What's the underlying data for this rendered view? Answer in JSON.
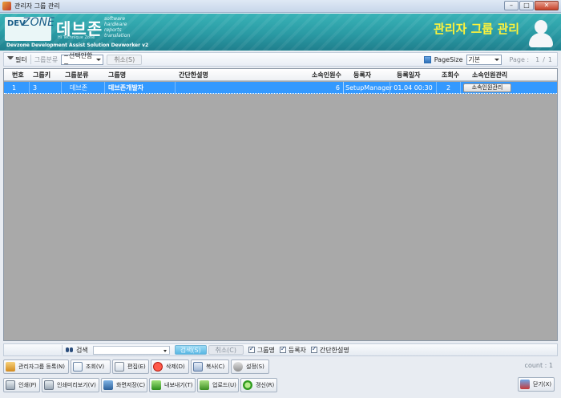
{
  "window": {
    "title": "관리자 그룹 관리"
  },
  "banner": {
    "logo_dev": "DEV",
    "logo_zone": "ZONE",
    "logo_korean": "데브존",
    "logo_tagline": "Hi Technique Zone",
    "logo_words": [
      "software",
      "hardware",
      "reports",
      "translation"
    ],
    "subtitle": "Devzone Development Assist Solution Devworker v2",
    "page_title": "관리자 그룹 관리"
  },
  "filterbar": {
    "filter_label": "필터",
    "group_class_label": "그룹분류",
    "group_class_value": "~선택안함~",
    "cancel_label": "취소(S)",
    "pagesize_label": "PageSize",
    "pagesize_value": "기본",
    "page_label": "Page :",
    "page_current": "1",
    "page_sep": "/",
    "page_total": "1"
  },
  "grid": {
    "columns": [
      "번호",
      "그룹키",
      "그룹분류",
      "그룹명",
      "간단한설명",
      "소속인원수",
      "등록자",
      "등록일자",
      "조회수",
      "소속인원관리"
    ],
    "rows": [
      {
        "no": "1",
        "key": "3",
        "class": "데브존",
        "name": "데브존개발자",
        "desc": "",
        "members": "6",
        "registrar": "SetupManager",
        "date": "01.04 00:30",
        "views": "2",
        "action": "소속인원관리"
      }
    ]
  },
  "searchbar": {
    "search_label": "검색",
    "search_value": "",
    "search_button": "검색(S)",
    "cancel_button": "취소(C)",
    "checks": [
      "그룹명",
      "등록자",
      "간단한설명"
    ]
  },
  "actions_row1": [
    "관리자그룹 등록(N)",
    "조회(V)",
    "편집(E)",
    "삭제(D)",
    "복사(C)",
    "설정(S)"
  ],
  "count_text": "count : 1",
  "actions_row2": [
    "인쇄(P)",
    "인쇄미리보기(V)",
    "화면저장(C)",
    "내보내기(T)",
    "업로드(U)",
    "갱신(R)"
  ],
  "close_label": "닫기(X)"
}
